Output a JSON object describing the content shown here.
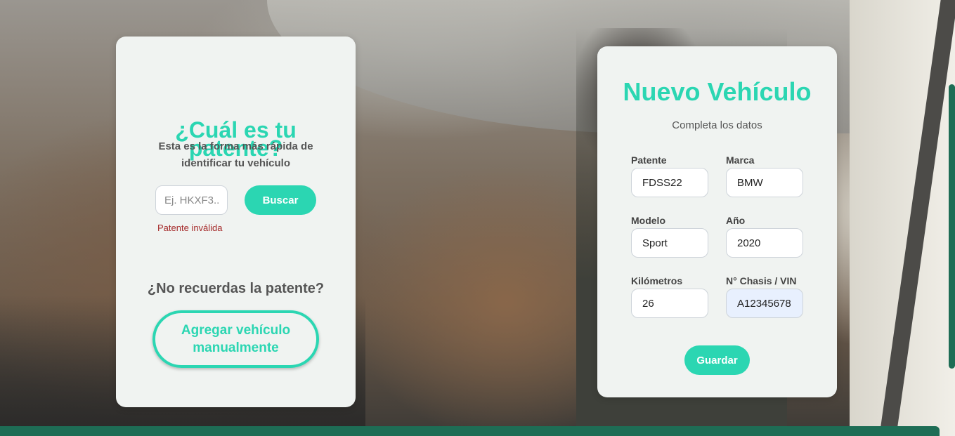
{
  "lookup": {
    "title_line1": "¿Cuál es tu",
    "title_line2": "patente?",
    "subtitle": "Esta es la forma más rápida de identificar tu vehículo",
    "plate_placeholder": "Ej. HKXF3...",
    "plate_value": "",
    "search_label": "Buscar",
    "error_text": "Patente inválida",
    "forgot_text": "¿No recuerdas la patente?",
    "manual_line1": "Agregar vehículo",
    "manual_line2": "manualmente"
  },
  "new_vehicle": {
    "title": "Nuevo Vehículo",
    "subtitle": "Completa los datos",
    "fields": [
      {
        "label": "Patente",
        "value": "FDSS22"
      },
      {
        "label": "Marca",
        "value": "BMW"
      },
      {
        "label": "Modelo",
        "value": "Sport"
      },
      {
        "label": "Año",
        "value": "2020"
      },
      {
        "label": "Kilómetros",
        "value": "26"
      },
      {
        "label": "N° Chasis / VIN",
        "value": "A12345678"
      }
    ],
    "save_label": "Guardar"
  },
  "colors": {
    "accent": "#2bd6b2",
    "error": "#a52a2a",
    "card_bg": "#f0f3f1",
    "bar": "#1e6d55"
  }
}
